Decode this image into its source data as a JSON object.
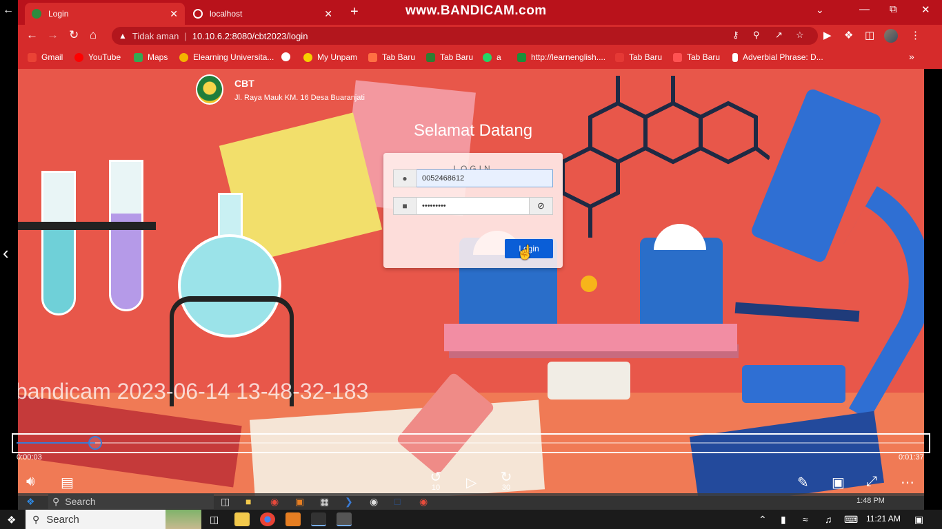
{
  "browser": {
    "tabs": [
      {
        "title": "Login",
        "active": true
      },
      {
        "title": "localhost",
        "active": false
      }
    ],
    "watermark": "www.BANDICAM.com",
    "security_label": "Tidak aman",
    "url": "10.10.6.2:8080/cbt2023/login",
    "bookmarks": [
      {
        "label": "Gmail",
        "color": "#ea4335"
      },
      {
        "label": "YouTube",
        "color": "#ff0000"
      },
      {
        "label": "Maps",
        "color": "#34a853"
      },
      {
        "label": "Elearning Universita...",
        "color": "#f4b400"
      },
      {
        "label": "",
        "color": "#4285f4"
      },
      {
        "label": "My Unpam",
        "color": "#f7d000"
      },
      {
        "label": "Tab Baru",
        "color": "#ff7043"
      },
      {
        "label": "Tab Baru",
        "color": "#2e7d32"
      },
      {
        "label": "a",
        "color": "#25d366"
      },
      {
        "label": "http://learnenglish....",
        "color": "#1b8f3a"
      },
      {
        "label": "Tab Baru",
        "color": "#e53935"
      },
      {
        "label": "Tab Baru",
        "color": "#ff5252"
      },
      {
        "label": "Adverbial Phrase: D...",
        "color": "#ffffff"
      }
    ]
  },
  "page": {
    "brand": "CBT",
    "address": "Jl. Raya Mauk KM. 16 Desa Buaranjati",
    "welcome": "Selamat Datang",
    "login": {
      "heading": "LOGIN",
      "username_value": "0052468612",
      "password_value": "•••••••••",
      "button_label": "Login"
    }
  },
  "player": {
    "video_title": "bandicam 2023-06-14 13-48-32-183",
    "current_time": "0:00:03",
    "total_time": "0:01:37",
    "progress_fraction": 0.087,
    "skip_back": "10",
    "skip_forward": "30"
  },
  "inner_taskbar": {
    "search_placeholder": "Search",
    "time": "1:48 PM"
  },
  "taskbar": {
    "search_placeholder": "Search",
    "time": "11:21 AM"
  },
  "colors": {
    "browser_red": "#d62b2b",
    "tab_bar_red": "#b9121b",
    "login_button": "#0a5ed7",
    "progress_blue": "#3a7bd5"
  }
}
